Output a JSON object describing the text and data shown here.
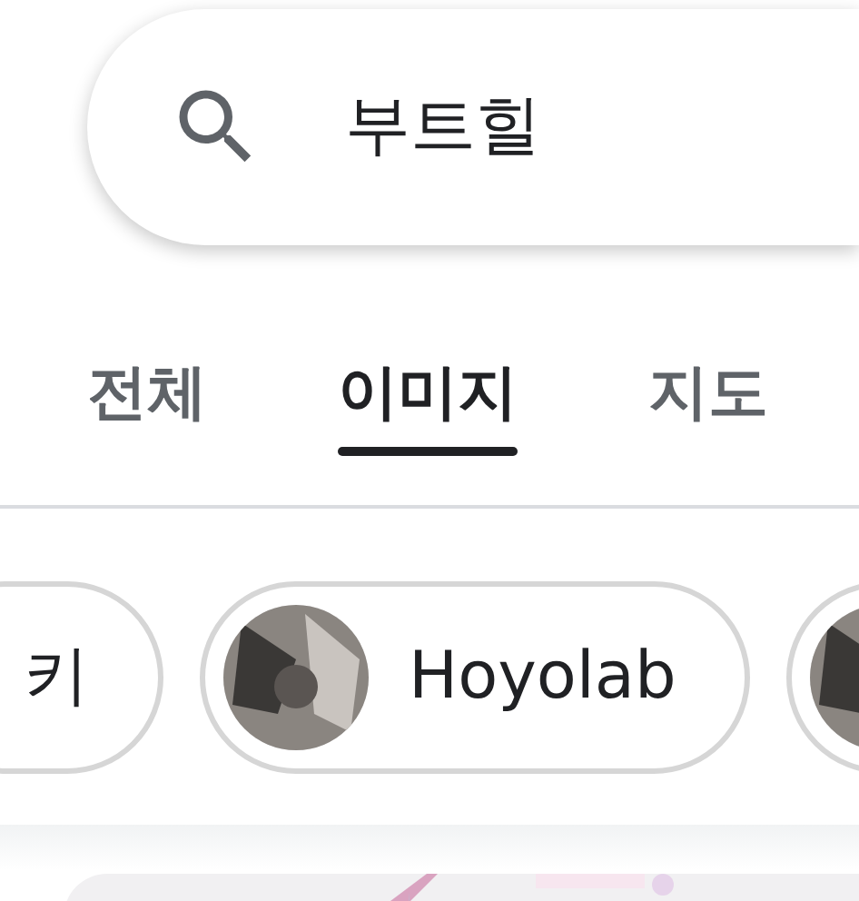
{
  "search": {
    "value": "부트힐"
  },
  "tabs": [
    {
      "label": "전체",
      "selected": false
    },
    {
      "label": "이미지",
      "selected": true
    },
    {
      "label": "지도",
      "selected": false
    }
  ],
  "chips": [
    {
      "label": "키",
      "avatar": false
    },
    {
      "label": "Hoyolab",
      "avatar": true
    },
    {
      "avatar": true
    }
  ]
}
